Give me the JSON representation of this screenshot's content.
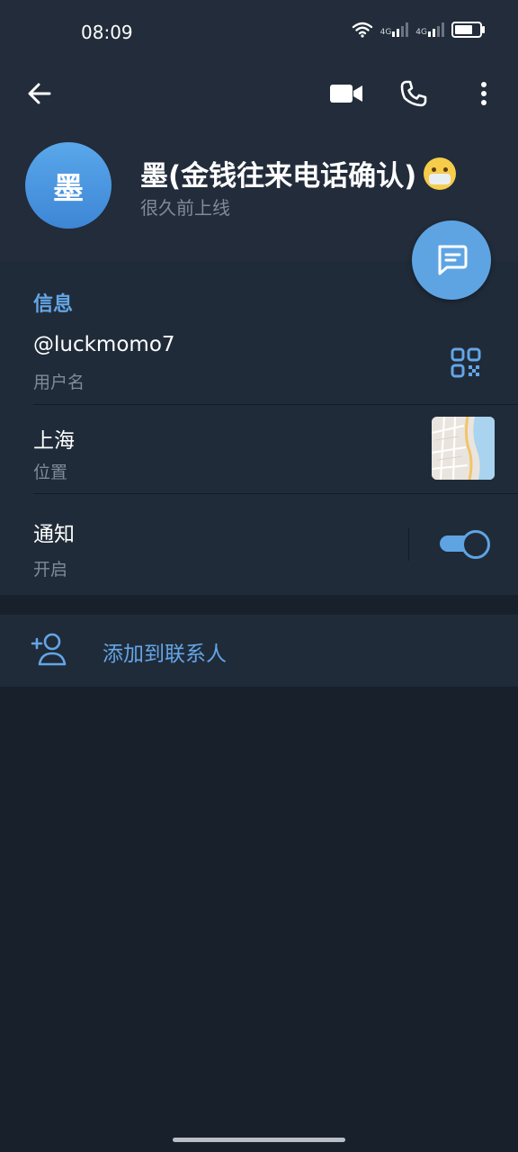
{
  "status_bar": {
    "time": "08:09",
    "network_1": "4G",
    "network_2": "4G",
    "battery_level": 0.9
  },
  "toolbar": {
    "back_icon": "arrow-left-icon",
    "video_icon": "video-camera-icon",
    "phone_icon": "phone-icon",
    "more_icon": "more-vertical-icon"
  },
  "profile": {
    "avatar_letter": "墨",
    "name": "墨(金钱往来电话确认)",
    "emoji": "face-with-mask-emoji",
    "last_seen": "很久前上线",
    "avatar_color": "#4a95e0"
  },
  "fab": {
    "icon": "message-icon",
    "color": "#5ea4e3"
  },
  "info": {
    "section_title": "信息",
    "username": "@luckmomo7",
    "username_label": "用户名",
    "location": "上海",
    "location_label": "位置",
    "notifications": "通知",
    "notifications_status": "开启",
    "notifications_enabled": true
  },
  "actions": {
    "add_contact_label": "添加到联系人",
    "add_contact_icon": "add-user-icon"
  },
  "colors": {
    "accent": "#64a6e6",
    "background": "#18202b",
    "card": "#202b39",
    "header": "#222c3a"
  }
}
